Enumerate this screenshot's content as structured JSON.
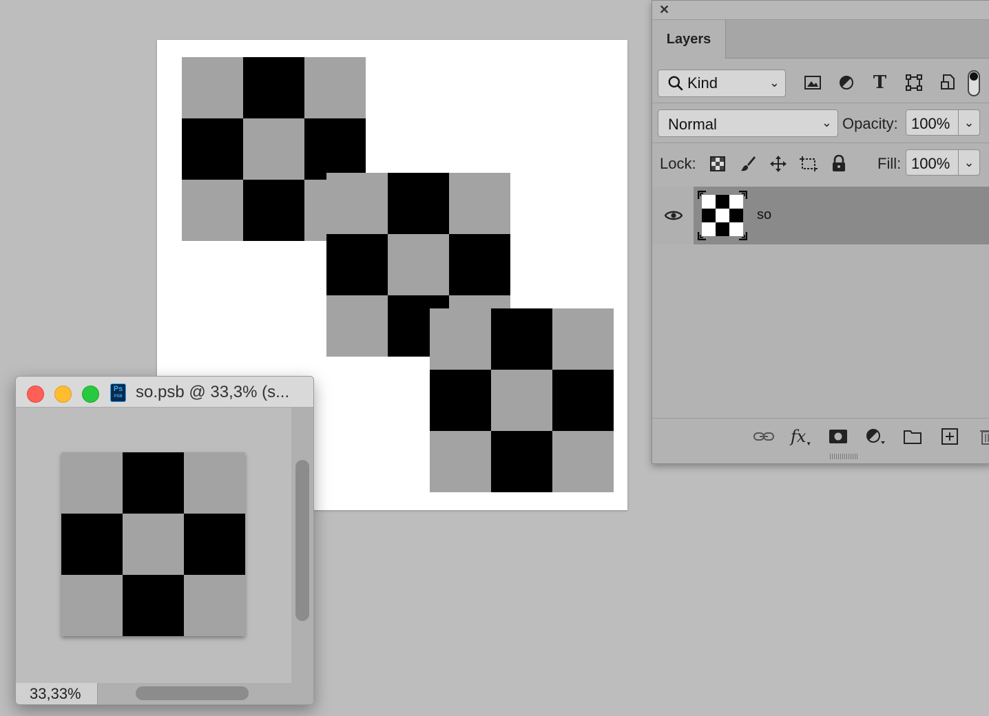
{
  "layers_panel": {
    "tab_label": "Layers",
    "kind_filter": "Kind",
    "blend_mode": "Normal",
    "opacity_label": "Opacity:",
    "opacity_value": "100%",
    "lock_label": "Lock:",
    "fill_label": "Fill:",
    "fill_value": "100%",
    "layers": [
      {
        "name": "so",
        "visible": true
      }
    ]
  },
  "document_window": {
    "title": "so.psb @ 33,3% (s...",
    "app_badge": "Ps",
    "app_badge_sub": "PSB",
    "zoom": "33,33%"
  }
}
